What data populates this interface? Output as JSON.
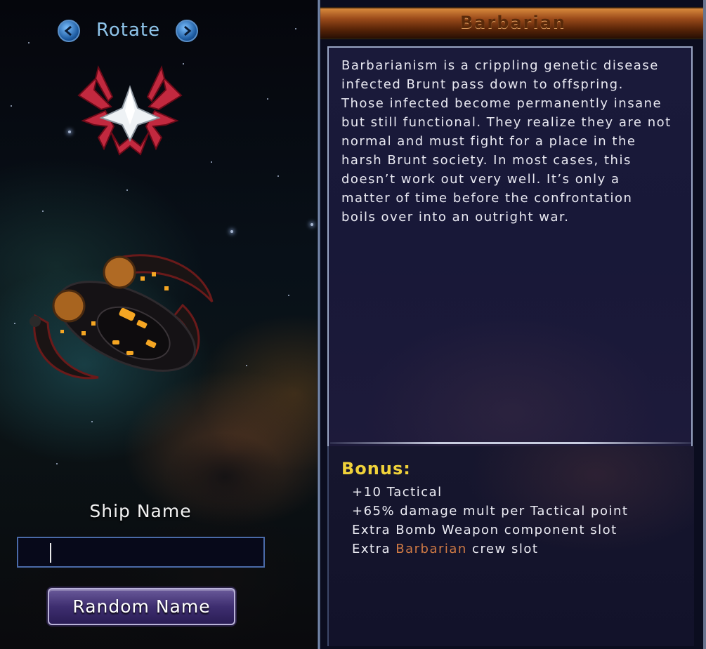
{
  "left_panel": {
    "rotate_label": "Rotate",
    "ship_name_label": "Ship Name",
    "ship_name_value": "",
    "random_name_label": "Random Name",
    "emblem_icon": "brunt-faction-emblem",
    "ship_icon": "brunt-barbarian-ship"
  },
  "right_panel": {
    "title": "Barbarian",
    "description": "Barbarianism is a crippling genetic disease infected Brunt pass down to offspring. Those infected become permanently insane but still functional. They realize they are not normal and must fight for a place in the harsh Brunt society. In most cases, this doesn’t work out very well. It’s only a matter of time before the confrontation boils over into an outright war.",
    "bonus_title": "Bonus:",
    "bonuses": [
      "+10 Tactical",
      "+65% damage mult per Tactical point",
      "Extra Bomb Weapon component slot"
    ],
    "crew_line": {
      "prefix": "Extra ",
      "highlight": "Barbarian",
      "suffix": " crew slot"
    }
  },
  "colors": {
    "bonus_title": "#f0d23a",
    "highlight": "#d07a45",
    "title_bar": "#9a4a1a",
    "button": "#3e2e70"
  }
}
